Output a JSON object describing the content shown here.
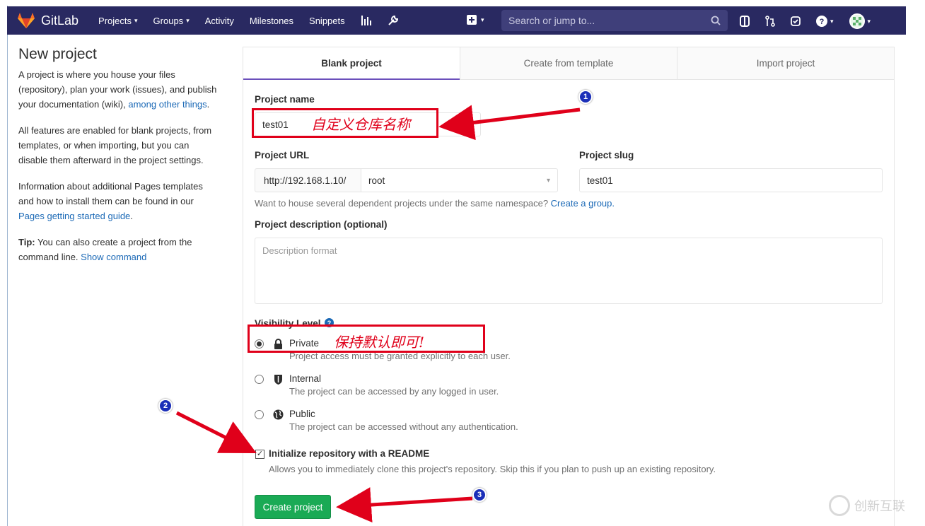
{
  "navbar": {
    "logo_text": "GitLab",
    "items": [
      {
        "label": "Projects",
        "caret": "▾"
      },
      {
        "label": "Groups",
        "caret": "▾"
      },
      {
        "label": "Activity"
      },
      {
        "label": "Milestones"
      },
      {
        "label": "Snippets"
      }
    ],
    "search_placeholder": "Search or jump to...",
    "brand_color": "#292961"
  },
  "info": {
    "title": "New project",
    "p1_text": "A project is where you house your files (repository), plan your work (issues), and publish your documentation (wiki), ",
    "p1_link": "among other things",
    "p1_end": ".",
    "p2": "All features are enabled for blank projects, from templates, or when importing, but you can disable them afterward in the project settings.",
    "p3_text": "Information about additional Pages templates and how to install them can be found in our ",
    "p3_link": "Pages getting started guide",
    "p3_end": ".",
    "tip_bold": "Tip:",
    "tip_text": " You can also create a project from the command line. ",
    "tip_link": "Show command"
  },
  "tabs": [
    {
      "label": "Blank project",
      "active": true
    },
    {
      "label": "Create from template"
    },
    {
      "label": "Import project"
    }
  ],
  "form": {
    "project_name_label": "Project name",
    "project_name_value": "test01",
    "project_url_label": "Project URL",
    "url_prefix": "http://192.168.1.10/",
    "namespace_value": "root",
    "project_slug_label": "Project slug",
    "project_slug_value": "test01",
    "group_hint": "Want to house several dependent projects under the same namespace? ",
    "group_hint_link": "Create a group.",
    "description_label": "Project description (optional)",
    "description_placeholder": "Description format",
    "visibility_label": "Visibility Level",
    "visibility_options": [
      {
        "title": "Private",
        "desc": "Project access must be granted explicitly to each user.",
        "selected": true,
        "icon": "lock-icon"
      },
      {
        "title": "Internal",
        "desc": "The project can be accessed by any logged in user.",
        "icon": "shield-icon"
      },
      {
        "title": "Public",
        "desc": "The project can be accessed without any authentication.",
        "icon": "globe-icon"
      }
    ],
    "readme_label": "Initialize repository with a README",
    "readme_checked": true,
    "readme_hint": "Allows you to immediately clone this project's repository. Skip this if you plan to push up an existing repository.",
    "create_button": "Create project",
    "create_color": "#1aaa55"
  },
  "annotations": {
    "note_name": "自定义仓库名称",
    "note_visibility": "保持默认即可!",
    "badges": [
      "1",
      "2",
      "3"
    ]
  },
  "watermark": {
    "text": "创新互联"
  }
}
